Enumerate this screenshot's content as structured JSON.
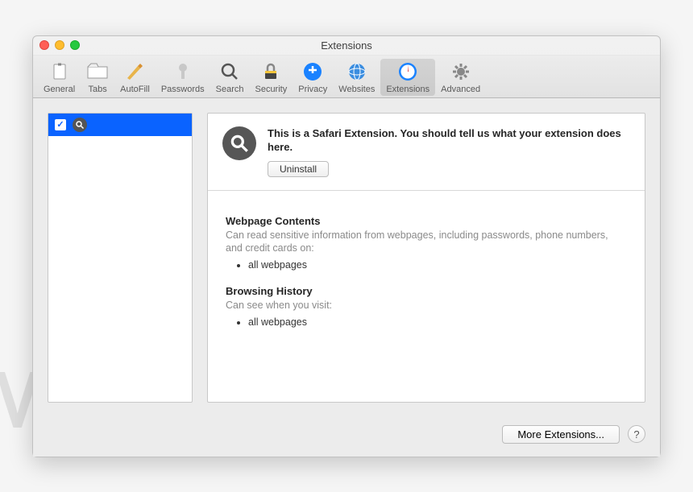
{
  "watermark": "MALWARETIPS",
  "window": {
    "title": "Extensions"
  },
  "toolbar": {
    "items": [
      {
        "label": "General"
      },
      {
        "label": "Tabs"
      },
      {
        "label": "AutoFill"
      },
      {
        "label": "Passwords"
      },
      {
        "label": "Search"
      },
      {
        "label": "Security"
      },
      {
        "label": "Privacy"
      },
      {
        "label": "Websites"
      },
      {
        "label": "Extensions",
        "active": true
      },
      {
        "label": "Advanced"
      }
    ]
  },
  "sidebar": {
    "items": [
      {
        "checked": true,
        "icon": "search-icon"
      }
    ]
  },
  "detail": {
    "description": "This is a Safari Extension. You should tell us what your extension does here.",
    "uninstall_label": "Uninstall",
    "permissions": [
      {
        "title": "Webpage Contents",
        "desc": "Can read sensitive information from webpages, including passwords, phone numbers, and credit cards on:",
        "items": [
          "all webpages"
        ]
      },
      {
        "title": "Browsing History",
        "desc": "Can see when you visit:",
        "items": [
          "all webpages"
        ]
      }
    ]
  },
  "footer": {
    "more_label": "More Extensions...",
    "help_label": "?"
  }
}
